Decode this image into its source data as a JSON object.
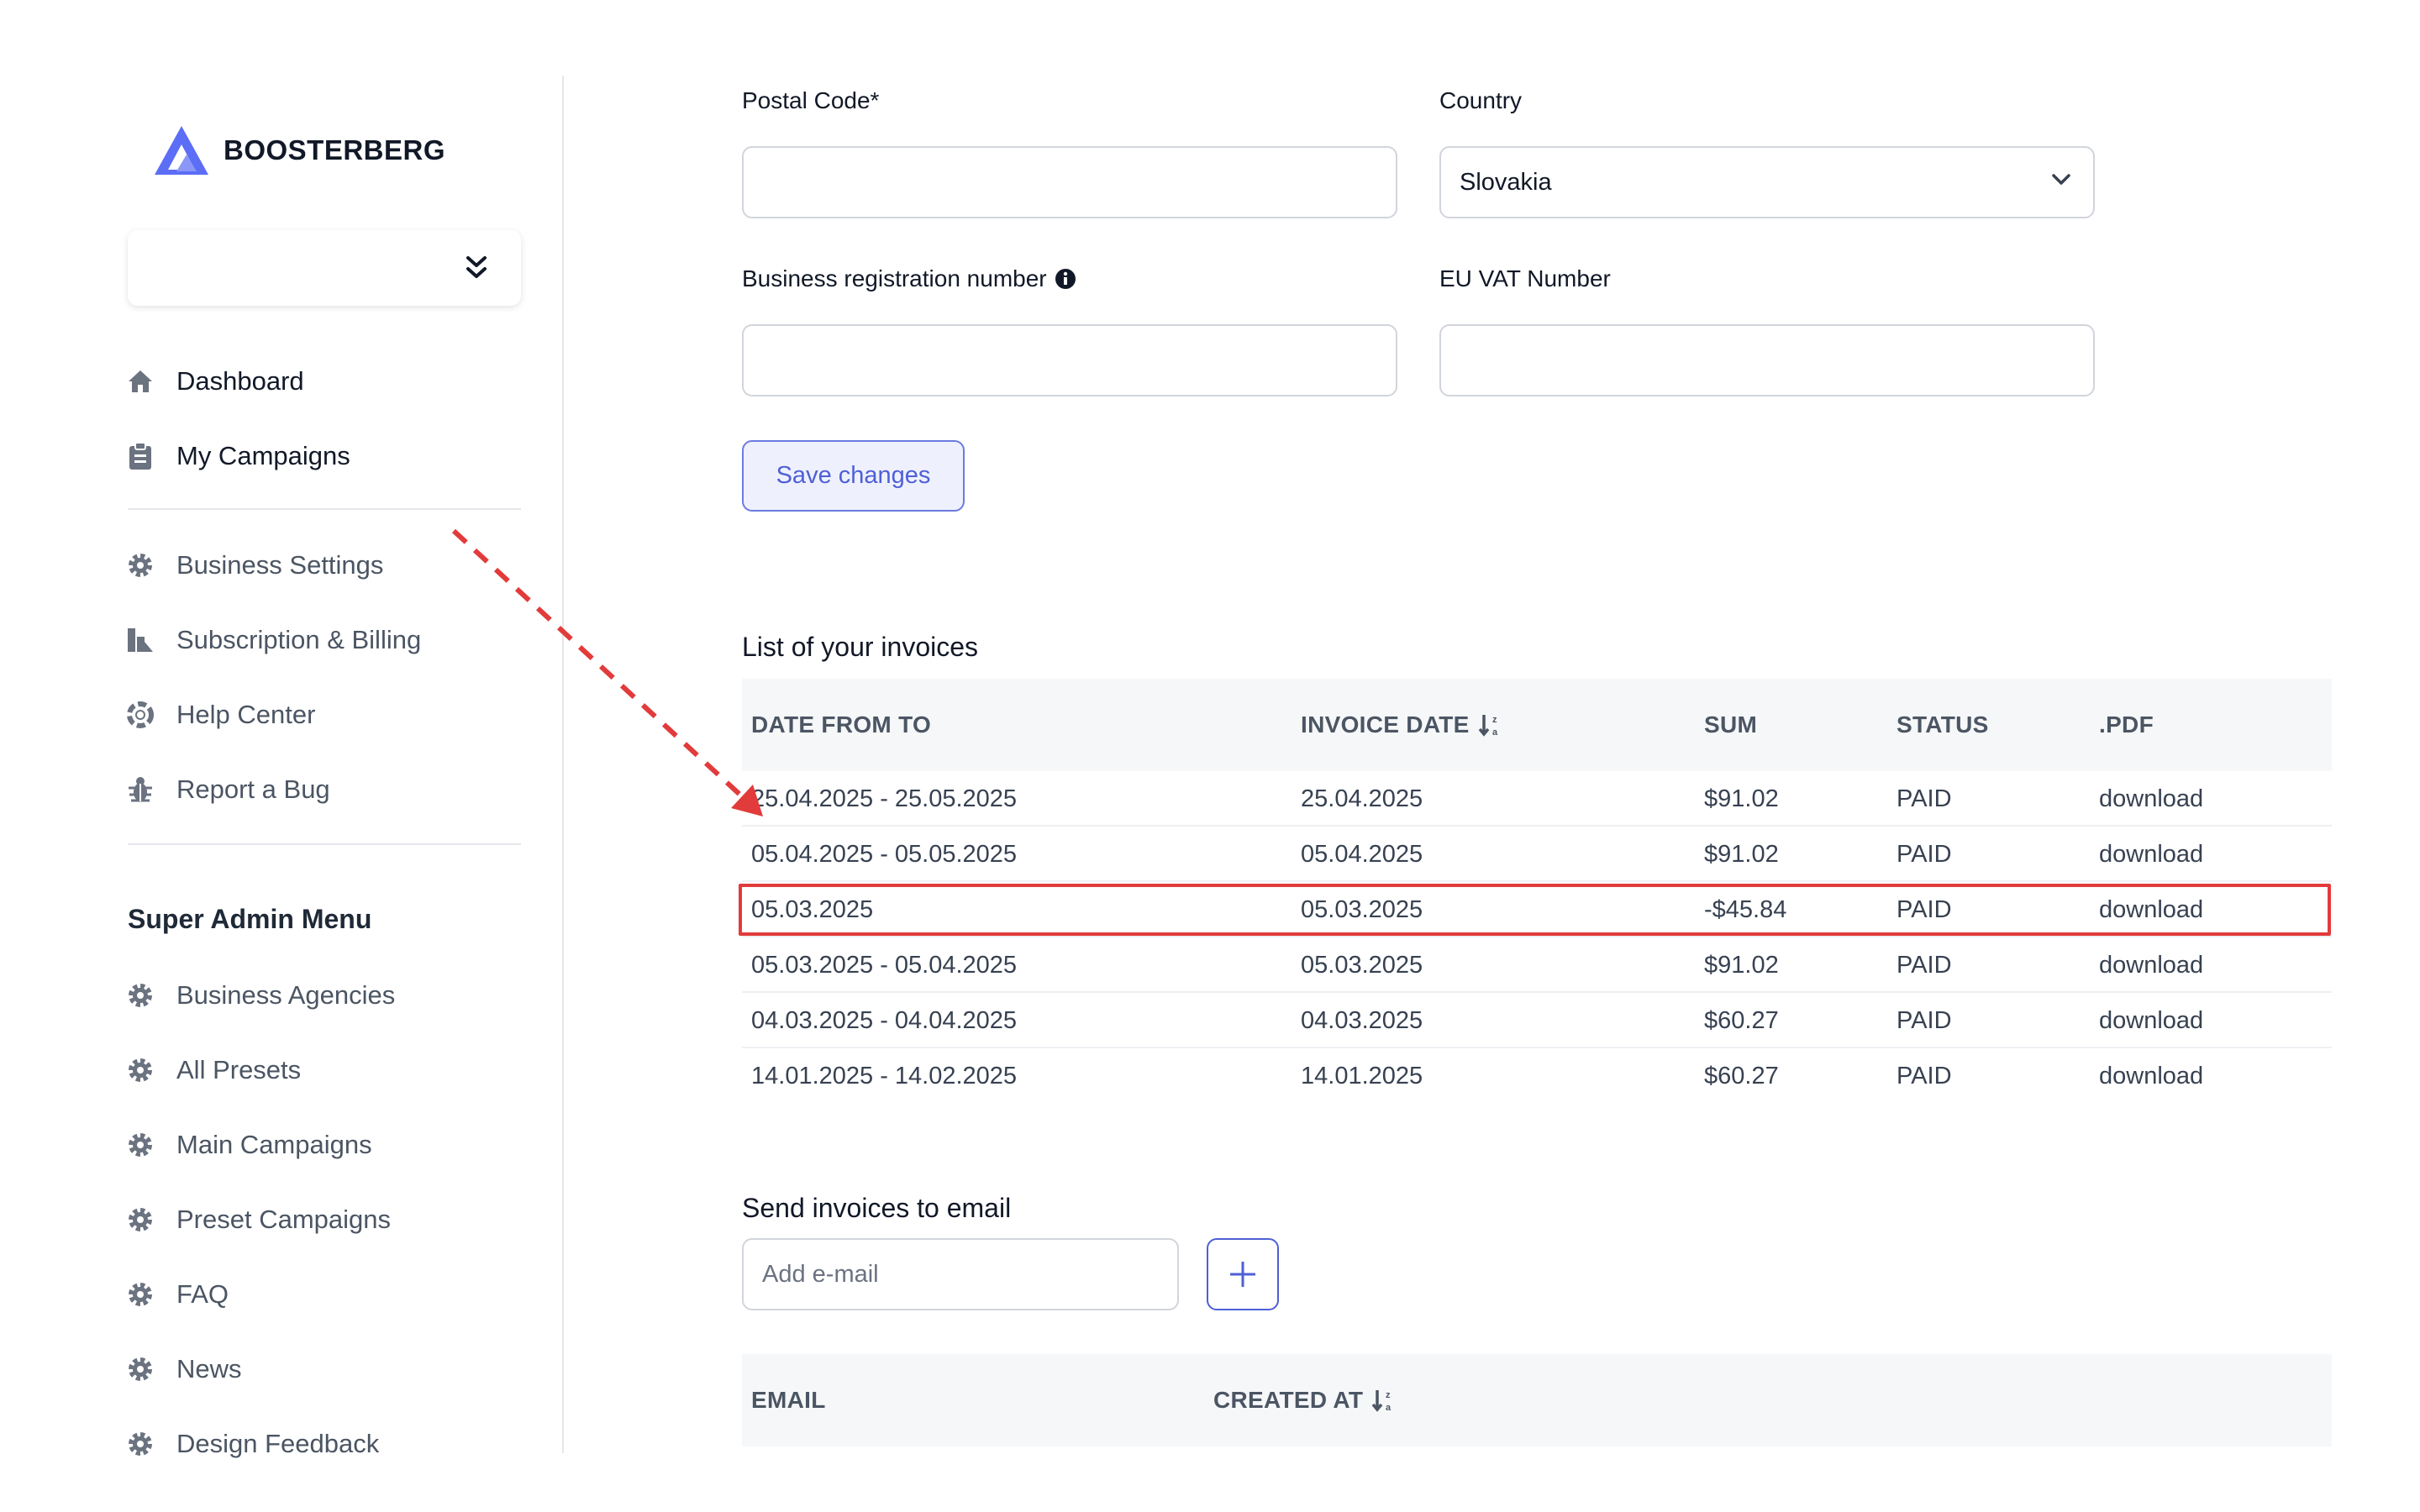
{
  "app": {
    "brand": "BOOSTERBERG"
  },
  "sidebar": {
    "primary_items": [
      {
        "label": "Dashboard",
        "icon": "home-icon"
      },
      {
        "label": "My Campaigns",
        "icon": "clipboard-icon"
      }
    ],
    "items": [
      {
        "label": "Business Settings",
        "icon": "gear-icon"
      },
      {
        "label": "Subscription & Billing",
        "icon": "billing-icon"
      },
      {
        "label": "Help Center",
        "icon": "lifebuoy-icon"
      },
      {
        "label": "Report a Bug",
        "icon": "bug-icon"
      }
    ],
    "admin_title": "Super Admin Menu",
    "admin_items": [
      {
        "label": "Business Agencies",
        "icon": "gear-icon"
      },
      {
        "label": "All Presets",
        "icon": "gear-icon"
      },
      {
        "label": "Main Campaigns",
        "icon": "gear-icon"
      },
      {
        "label": "Preset Campaigns",
        "icon": "gear-icon"
      },
      {
        "label": "FAQ",
        "icon": "gear-icon"
      },
      {
        "label": "News",
        "icon": "gear-icon"
      },
      {
        "label": "Design Feedback",
        "icon": "gear-icon"
      }
    ]
  },
  "form": {
    "postal_code": {
      "label": "Postal Code*",
      "value": ""
    },
    "country": {
      "label": "Country",
      "value": "Slovakia"
    },
    "business_reg": {
      "label": "Business registration number",
      "value": ""
    },
    "eu_vat": {
      "label": "EU VAT Number",
      "value": ""
    },
    "save_label": "Save changes"
  },
  "invoices": {
    "heading": "List of your invoices",
    "columns": [
      "DATE FROM TO",
      "INVOICE DATE",
      "SUM",
      "STATUS",
      ".PDF"
    ],
    "rows": [
      [
        "25.04.2025 - 25.05.2025",
        "25.04.2025",
        "$91.02",
        "PAID",
        "download"
      ],
      [
        "05.04.2025 - 05.05.2025",
        "05.04.2025",
        "$91.02",
        "PAID",
        "download"
      ],
      [
        "05.03.2025",
        "05.03.2025",
        "-$45.84",
        "PAID",
        "download"
      ],
      [
        "05.03.2025 - 05.04.2025",
        "05.03.2025",
        "$91.02",
        "PAID",
        "download"
      ],
      [
        "04.03.2025 - 04.04.2025",
        "04.03.2025",
        "$60.27",
        "PAID",
        "download"
      ],
      [
        "14.01.2025 - 14.02.2025",
        "14.01.2025",
        "$60.27",
        "PAID",
        "download"
      ]
    ],
    "highlighted_row": 2
  },
  "email_invoices": {
    "heading": "Send invoices to email",
    "placeholder": "Add e-mail",
    "columns": [
      "EMAIL",
      "CREATED AT"
    ]
  },
  "colors": {
    "accent": "#4f5fd6",
    "annotation": "#e23b3b",
    "logo": "#5b6ef5"
  }
}
